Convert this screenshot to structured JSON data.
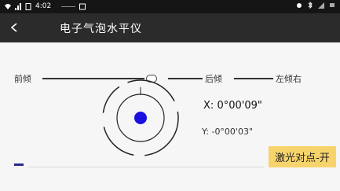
{
  "status_bar": {
    "time": "4:02"
  },
  "header": {
    "title": "电子气泡水平仪"
  },
  "level": {
    "left_label": "前倾",
    "mid_label": "后倾",
    "right_label": "左倾右"
  },
  "readouts": {
    "x_label": "X:",
    "x_value": "0°00'09\"",
    "y_label": "Y:",
    "y_value": "-0°00'03\""
  },
  "laser_button": {
    "label": "激光对点-开"
  },
  "colors": {
    "accent_dot": "#1a10e0",
    "button": "#f7d36b",
    "topbar": "#2b2b2b"
  }
}
